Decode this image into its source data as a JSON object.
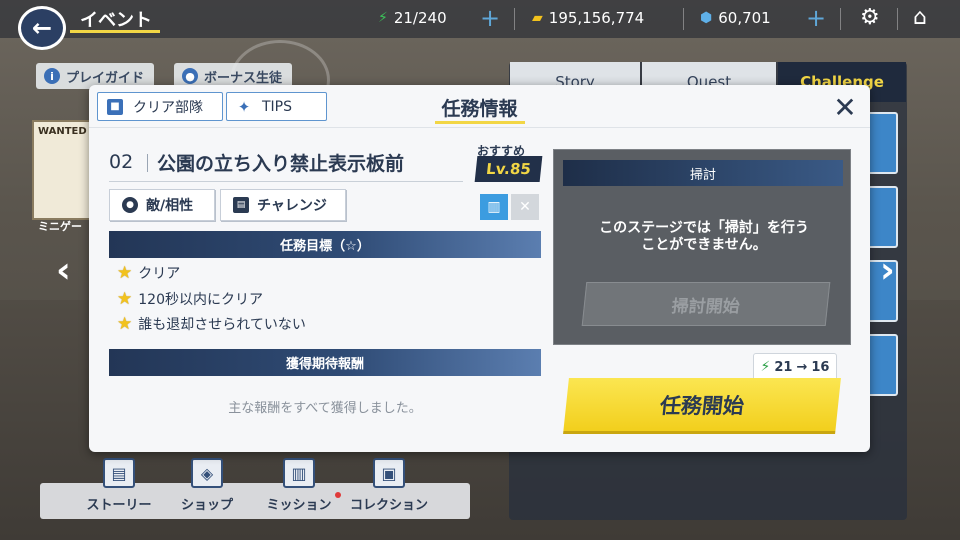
{
  "topbar": {
    "title": "イベント",
    "stamina": "21/240",
    "coins": "195,156,774",
    "gems": "60,701"
  },
  "chips": {
    "play_guide": "プレイガイド",
    "bonus_students": "ボーナス生徒"
  },
  "right_tabs": [
    "Story",
    "Quest",
    "Challenge"
  ],
  "side_label": "ミニゲー",
  "modal": {
    "tab_clear_team": "クリア部隊",
    "tab_tips": "TIPS",
    "title": "任務情報",
    "stage_number": "02",
    "stage_name": "公園の立ち入り禁止表示板前",
    "recommended_label": "おすすめ",
    "recommended_level": "Lv.85",
    "enemy_button": "敵/相性",
    "challenge_button": "チャレンジ",
    "objectives_header": "任務目標（☆）",
    "objectives": [
      "クリア",
      "120秒以内にクリア",
      "誰も退却させられていない"
    ],
    "rewards_header": "獲得期待報酬",
    "rewards_message": "主な報酬をすべて獲得しました。",
    "sweep_header": "掃討",
    "sweep_message": "このステージでは「掃討」を行うことができません。",
    "sweep_button": "掃討開始",
    "cost_from": "21",
    "cost_arrow": "→",
    "cost_to": "16",
    "start_button": "任務開始"
  },
  "bottom_nav": [
    "ストーリー",
    "ショップ",
    "ミッション",
    "コレクション"
  ],
  "colors": {
    "navy": "#2b3a52",
    "accent_yellow": "#f2d645",
    "button_yellow": "#f7dc33",
    "link_blue": "#3b70b8",
    "stamina_green": "#2fa24a"
  },
  "icons": {
    "back": "back-arrow-icon",
    "stamina": "lightning-bolt-icon",
    "coin": "coin-icon",
    "gem": "gem-icon",
    "settings": "gear-icon",
    "home": "home-icon",
    "close": "close-icon",
    "star": "star-icon"
  }
}
